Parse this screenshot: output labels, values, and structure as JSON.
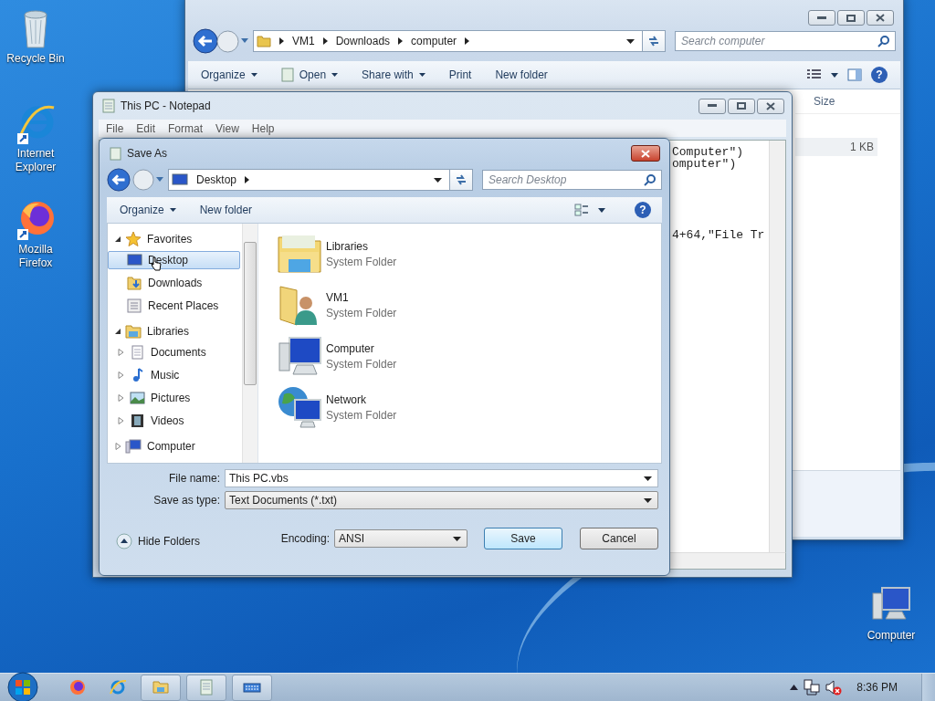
{
  "desktop_icons": [
    {
      "kind": "recycle",
      "label": "Recycle Bin"
    },
    {
      "kind": "ie",
      "label": "Internet Explorer"
    },
    {
      "kind": "firefox",
      "label": "Mozilla Firefox"
    },
    {
      "kind": "computer",
      "label": "Computer"
    }
  ],
  "explorer": {
    "breadcrumbs": [
      "VM1",
      "Downloads",
      "computer"
    ],
    "search_placeholder": "Search computer",
    "toolbar": [
      {
        "label": "Organize",
        "dropdown": true,
        "icon": false
      },
      {
        "label": "Open",
        "dropdown": true,
        "icon": true
      },
      {
        "label": "Share with",
        "dropdown": true,
        "icon": false
      },
      {
        "label": "Print",
        "dropdown": false,
        "icon": false
      },
      {
        "label": "New folder",
        "dropdown": false,
        "icon": false
      }
    ],
    "column": "Size",
    "cell": "1 KB",
    "help_icon": "?"
  },
  "notepad": {
    "title": "This PC - Notepad",
    "menu": [
      "File",
      "Edit",
      "Format",
      "View",
      "Help"
    ],
    "text_blocks": [
      [
        "Computer\")",
        "omputer\")"
      ],
      [
        "4+64,\"File Tr"
      ]
    ]
  },
  "save_as": {
    "title": "Save As",
    "help_icon": "?",
    "location": "Desktop",
    "search_placeholder": "Search Desktop",
    "toolbar": [
      {
        "label": "Organize",
        "dropdown": true
      },
      {
        "label": "New folder",
        "dropdown": false
      }
    ],
    "nav": [
      {
        "kind": "star",
        "label": "Favorites",
        "expanded": true,
        "children": [
          {
            "kind": "desktop",
            "label": "Desktop",
            "selected": true
          },
          {
            "kind": "downloads",
            "label": "Downloads",
            "selected": false
          },
          {
            "kind": "recent",
            "label": "Recent Places",
            "selected": false
          }
        ]
      },
      {
        "kind": "library",
        "label": "Libraries",
        "expanded": true,
        "children": [
          {
            "kind": "documents",
            "label": "Documents",
            "selected": false
          },
          {
            "kind": "music",
            "label": "Music",
            "selected": false
          },
          {
            "kind": "pictures",
            "label": "Pictures",
            "selected": false
          },
          {
            "kind": "videos",
            "label": "Videos",
            "selected": false
          }
        ]
      },
      {
        "kind": "computer",
        "label": "Computer",
        "expanded": false
      }
    ],
    "items": [
      {
        "kind": "library",
        "name": "Libraries",
        "type": "System Folder"
      },
      {
        "kind": "user",
        "name": "VM1",
        "type": "System Folder"
      },
      {
        "kind": "computer",
        "name": "Computer",
        "type": "System Folder"
      },
      {
        "kind": "network",
        "name": "Network",
        "type": "System Folder"
      }
    ],
    "file_name_label": "File name:",
    "file_name": "This PC.vbs",
    "type_label": "Save as type:",
    "type_value": "Text Documents (*.txt)",
    "hide_folders": "Hide Folders",
    "encoding_label": "Encoding:",
    "encoding": "ANSI",
    "save": "Save",
    "cancel": "Cancel"
  },
  "taskbar": {
    "pinned": [
      {
        "kind": "firefox"
      },
      {
        "kind": "ie"
      },
      {
        "kind": "explorer"
      },
      {
        "kind": "notepad"
      },
      {
        "kind": "keyboard"
      }
    ],
    "clock": "8:36 PM"
  }
}
